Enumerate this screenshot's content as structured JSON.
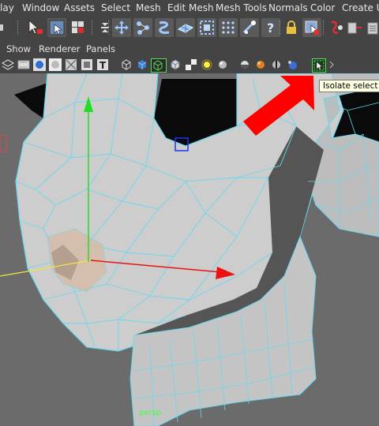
{
  "menubar": {
    "items": [
      "lay",
      "Window",
      "Assets",
      "Select",
      "Mesh",
      "Edit Mesh",
      "Mesh Tools",
      "Normals",
      "Color",
      "Create UV"
    ]
  },
  "toolbar": {
    "icons": [
      "select-icon",
      "lasso-icon",
      "paint-select-icon",
      "move-icon",
      "rotate-icon",
      "scale-icon",
      "soft-select-icon",
      "snap-grid-icon",
      "snap-curve-icon",
      "snap-point-icon",
      "snap-plane-icon",
      "help-icon",
      "lock-icon",
      "selection-mask-icon",
      "history-icon",
      "render-icon"
    ]
  },
  "panel_menu": {
    "items": [
      "Show",
      "Renderer",
      "Panels"
    ]
  },
  "tooltip": {
    "text": "Isolate select"
  },
  "viewport": {
    "camera_label": "persp"
  },
  "colors": {
    "wireframe": "#66d9f0",
    "arrow": "#ff0000",
    "axis_y": "#22dd22",
    "axis_x": "#ee1111",
    "background": "#6b6b6b"
  }
}
